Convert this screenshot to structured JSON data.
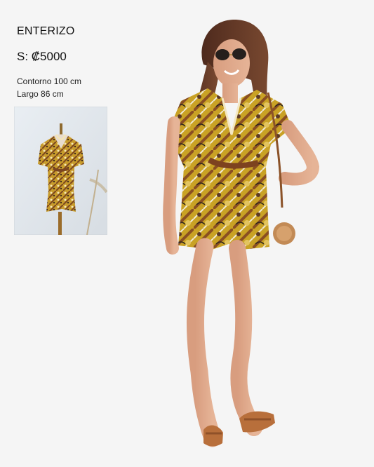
{
  "product": {
    "title": "ENTERIZO",
    "price": "S: ₡5000",
    "measurements": [
      "Contorno 100 cm",
      "Largo 86 cm"
    ]
  },
  "media": {
    "thumbnail_icon": "mannequin-photo-icon",
    "main_icon": "model-photo-icon"
  },
  "colors": {
    "background": "#f5f5f5",
    "text": "#111111",
    "print_gold": "#c9a225",
    "print_brown": "#8a4f22",
    "skin": "#dea889",
    "sandal": "#b86f3b"
  }
}
